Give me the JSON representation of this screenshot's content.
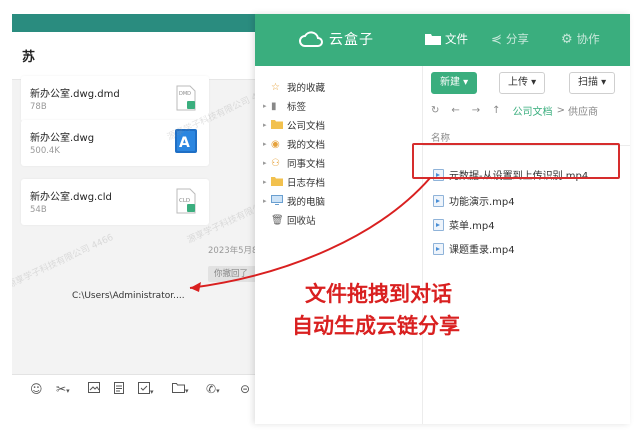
{
  "chat": {
    "title": "苏",
    "files": [
      {
        "name": "新办公室.dwg.dmd",
        "size": "78B",
        "icon": "dmd-file-icon"
      },
      {
        "name": "新办公室.dwg",
        "size": "500.4K",
        "icon": "autocad-file-icon"
      },
      {
        "name": "新办公室.dwg.cld",
        "size": "54B",
        "icon": "cld-file-icon"
      }
    ],
    "time": "2023年5月8",
    "recall": "你撤回了",
    "drop_path": "C:\\Users\\Administrator....",
    "toolbar": [
      "emoji-icon",
      "scissors-icon",
      "image-icon",
      "document-icon",
      "checkbox-icon",
      "folder-icon",
      "phone-icon",
      "more-icon"
    ],
    "watermark": "源享学子科技有限公司 4466"
  },
  "cloud": {
    "brand": "云盒子",
    "nav": {
      "files": "文件",
      "share": "分享",
      "collab": "协作"
    },
    "tree": [
      {
        "label": "我的收藏",
        "icon": "star-icon"
      },
      {
        "label": "标签",
        "icon": "tag-icon"
      },
      {
        "label": "公司文档",
        "icon": "folder-icon"
      },
      {
        "label": "我的文档",
        "icon": "user-icon"
      },
      {
        "label": "同事文档",
        "icon": "users-icon"
      },
      {
        "label": "日志存档",
        "icon": "folder-icon"
      },
      {
        "label": "我的电脑",
        "icon": "computer-icon"
      },
      {
        "label": "回收站",
        "icon": "trash-icon"
      }
    ],
    "toolbar": {
      "new": "新建 ▾",
      "upload": "上传 ▾",
      "scan": "扫描 ▾"
    },
    "breadcrumb": {
      "current": "公司文档",
      "sep": ">",
      "next": "供应商"
    },
    "column_header": "名称",
    "files": [
      "元数据-从设置到上传识别.mp4",
      "功能演示.mp4",
      "菜单.mp4",
      "课题重录.mp4"
    ]
  },
  "annotation": {
    "line1": "文件拖拽到对话",
    "line2": "自动生成云链分享",
    "color": "#d92020"
  }
}
